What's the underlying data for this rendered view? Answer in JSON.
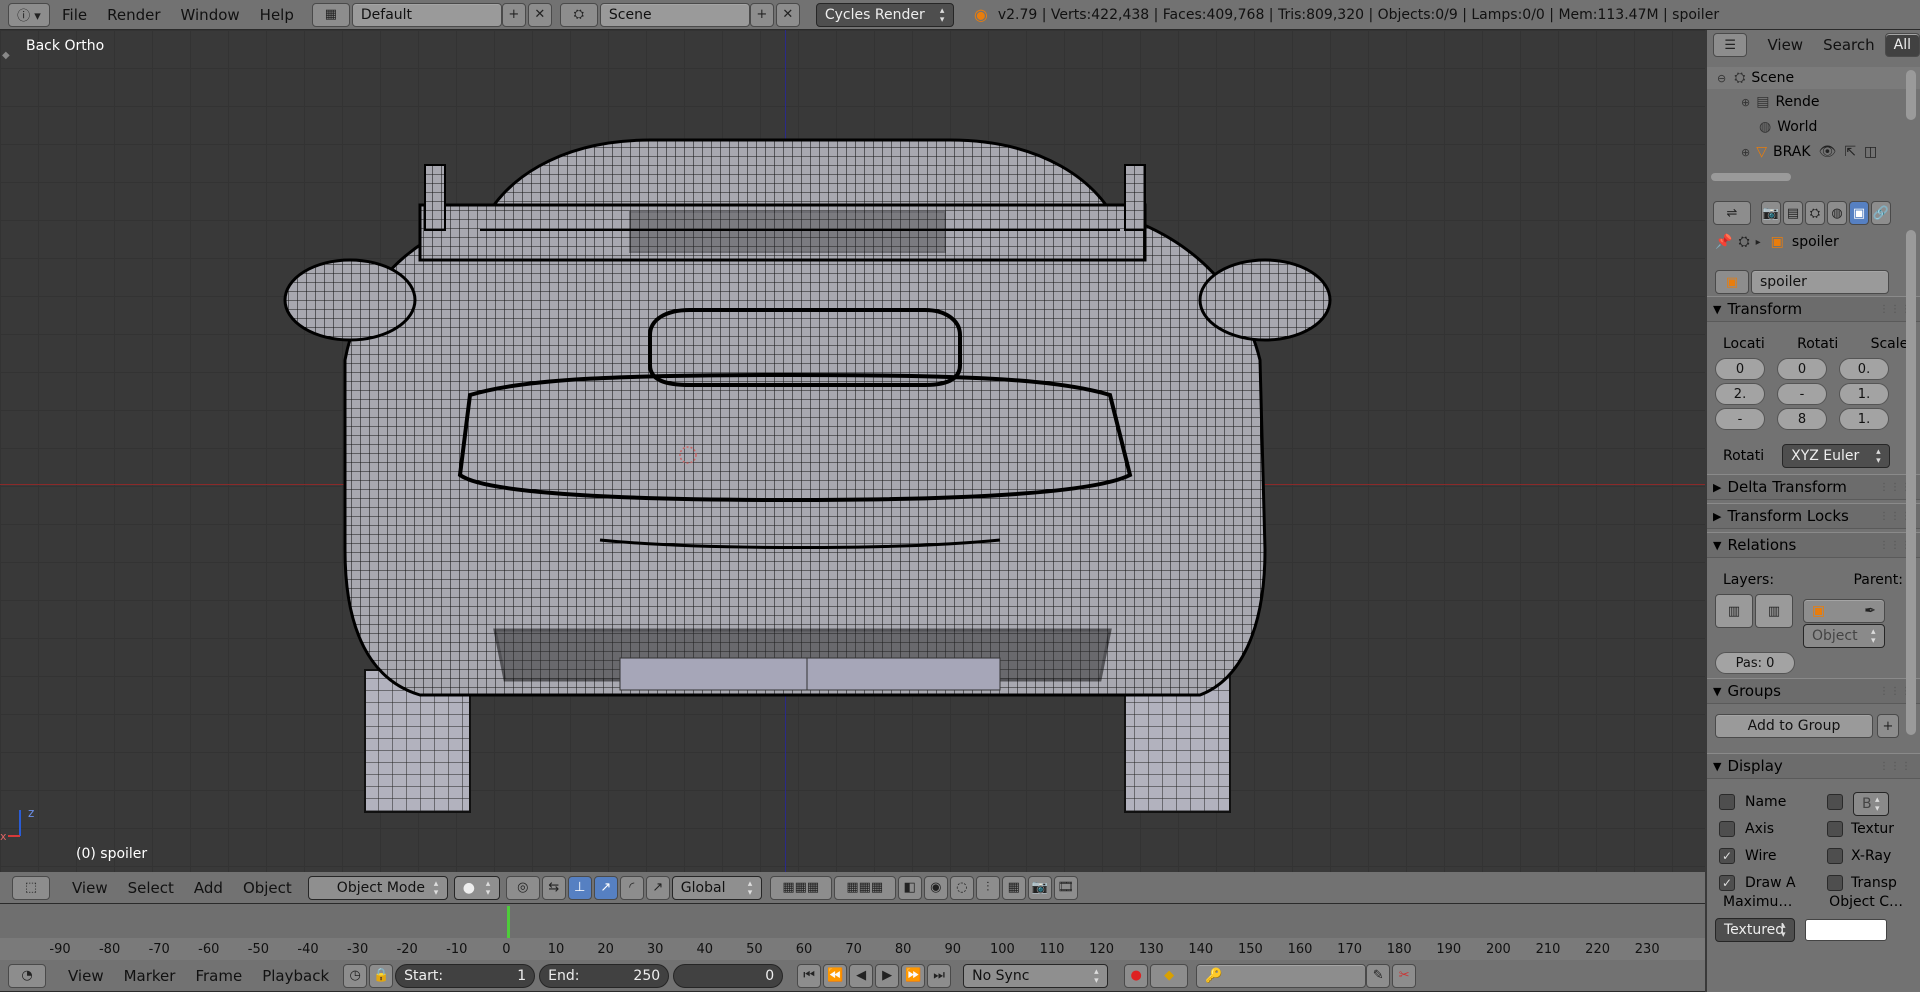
{
  "top_bar": {
    "menus": [
      "File",
      "Render",
      "Window",
      "Help"
    ],
    "layout": "Default",
    "scene": "Scene",
    "engine": "Cycles Render",
    "stats": "v2.79 | Verts:422,438 | Faces:409,768 | Tris:809,320 | Objects:0/9 | Lamps:0/0 | Mem:113.47M | spoiler"
  },
  "viewport": {
    "view_name": "Back Ortho",
    "object_label": "(0) spoiler",
    "axis_x": "x",
    "axis_z": "z"
  },
  "view3d_header": {
    "menus": [
      "View",
      "Select",
      "Add",
      "Object"
    ],
    "mode": "Object Mode",
    "orientation": "Global"
  },
  "timeline": {
    "ticks": [
      "-90",
      "-80",
      "-70",
      "-60",
      "-50",
      "-40",
      "-30",
      "-20",
      "-10",
      "0",
      "10",
      "20",
      "30",
      "40",
      "50",
      "60",
      "70",
      "80",
      "90",
      "100",
      "110",
      "120",
      "130",
      "140",
      "150",
      "160",
      "170",
      "180",
      "190",
      "200",
      "210",
      "220",
      "230"
    ],
    "current_frame_marker": 0
  },
  "timeline_header": {
    "menus": [
      "View",
      "Marker",
      "Frame",
      "Playback"
    ],
    "start_label": "Start:",
    "start_value": "1",
    "end_label": "End:",
    "end_value": "250",
    "current": "0",
    "sync": "No Sync"
  },
  "outliner": {
    "menus": [
      "View",
      "Search",
      "All"
    ],
    "items": [
      "Scene",
      "Rende",
      "World",
      "BRAK"
    ]
  },
  "properties": {
    "breadcrumb": "spoiler",
    "object_name": "spoiler",
    "transform": {
      "title": "Transform",
      "location_label": "Locati",
      "rotation_label": "Rotati",
      "scale_label": "Scale:",
      "location": [
        "0",
        "2.",
        "-"
      ],
      "rotation": [
        "0",
        "-",
        "8"
      ],
      "scale": [
        "0.",
        "1.",
        "1."
      ],
      "mode_label": "Rotati",
      "mode_value": "XYZ Euler"
    },
    "delta_transform": "Delta Transform",
    "transform_locks": "Transform Locks",
    "relations": {
      "title": "Relations",
      "layers_label": "Layers:",
      "parent_label": "Parent:",
      "parent_type": "Object",
      "pass_index": "Pas: 0"
    },
    "groups": {
      "title": "Groups",
      "add_button": "Add to Group"
    },
    "display": {
      "title": "Display",
      "checks": [
        {
          "label": "Name",
          "checked": false
        },
        {
          "label": "Axis",
          "checked": false
        },
        {
          "label": "Wire",
          "checked": true
        },
        {
          "label": "Draw A",
          "checked": true
        }
      ],
      "checks_right": [
        {
          "label": "",
          "checked": false
        },
        {
          "label": "Textur",
          "checked": false
        },
        {
          "label": "X-Ray",
          "checked": false
        },
        {
          "label": "Transp",
          "checked": false
        }
      ],
      "bounds_value": "B",
      "maximum_label": "Maximu…",
      "object_color_label": "Object C…",
      "max_draw_type": "Textured"
    }
  }
}
